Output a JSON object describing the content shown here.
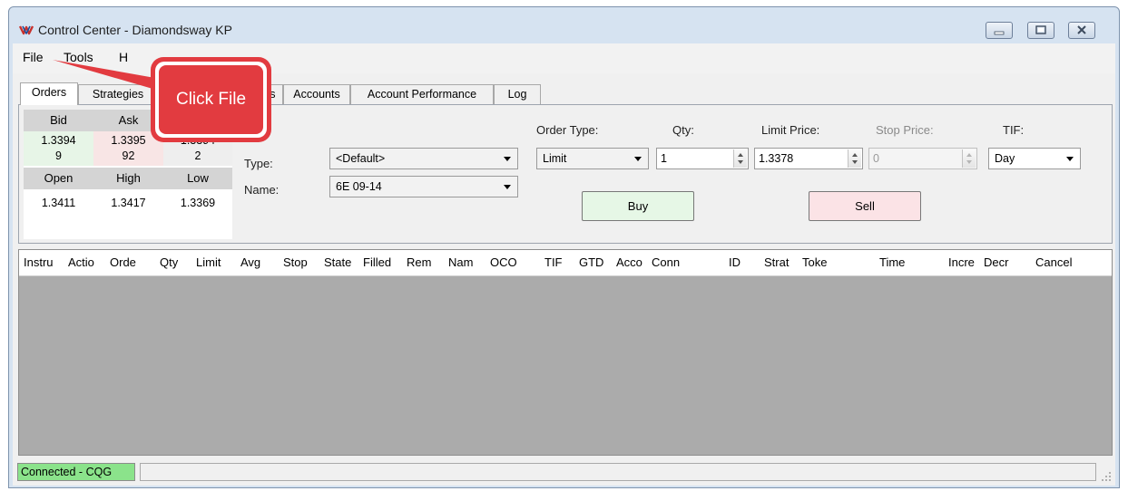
{
  "window": {
    "title": "Control Center - Diamondsway KP",
    "app_icon": "ninjatrader-logo-icon",
    "controls": [
      "minimize-icon",
      "maximize-icon",
      "close-icon"
    ]
  },
  "menubar": {
    "items": [
      "File",
      "Tools",
      "H"
    ]
  },
  "tabs": [
    "Orders",
    "Strategies",
    "ions",
    "Accounts",
    "Account Performance",
    "Log"
  ],
  "quote": {
    "bid_label": "Bid",
    "ask_label": "Ask",
    "bid": "1.3394",
    "ask": "1.3395",
    "last": "1.3394",
    "bid_size": "9",
    "ask_size": "92",
    "last_size": "2",
    "open_label": "Open",
    "high_label": "High",
    "low_label": "Low",
    "open": "1.3411",
    "high": "1.3417",
    "low": "1.3369"
  },
  "order_form": {
    "type_label": "Type:",
    "type_value": "<Default>",
    "name_label": "Name:",
    "name_value": "6E 09-14",
    "order_type_label": "Order Type:",
    "order_type_value": "Limit",
    "qty_label": "Qty:",
    "qty_value": "1",
    "limit_price_label": "Limit Price:",
    "limit_price_value": "1.3378",
    "stop_price_label": "Stop Price:",
    "stop_price_value": "0",
    "tif_label": "TIF:",
    "tif_value": "Day",
    "buy_label": "Buy",
    "sell_label": "Sell"
  },
  "orders_grid": {
    "columns": [
      "Instru",
      "Actio",
      "Orde",
      "Qty",
      "Limit",
      "Avg",
      "Stop",
      "State",
      "Filled",
      "Rem",
      "Nam",
      "OCO",
      "TIF",
      "GTD",
      "Acco",
      "Conn",
      "ID",
      "Strat",
      "Toke",
      "Time",
      "Incre",
      "Decr",
      "Cancel"
    ]
  },
  "statusbar": {
    "connection": "Connected - CQG"
  },
  "callout": {
    "text": "Click File"
  },
  "colors": {
    "connected_green": "#8be38b",
    "buy_green": "#e6f7e6",
    "sell_pink": "#fbe3e6",
    "callout_red": "#e0393e",
    "bid_cell": "#e7f5e7",
    "ask_cell": "#f8e5e5"
  }
}
